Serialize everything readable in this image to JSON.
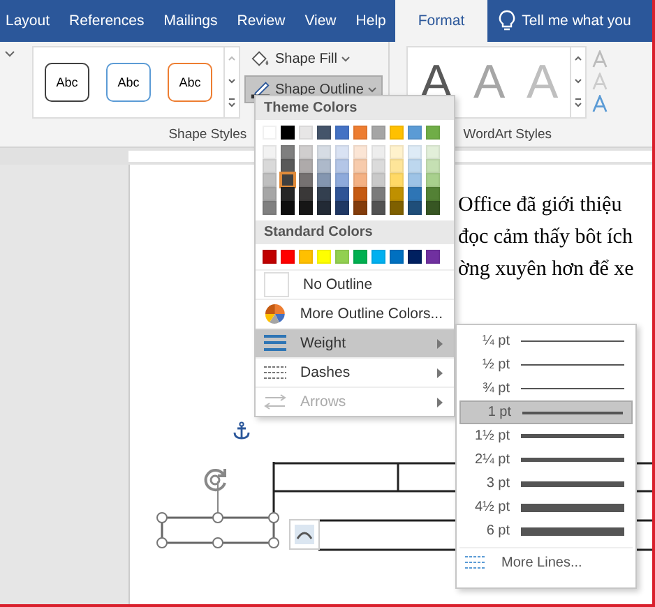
{
  "tabs": [
    {
      "label": "Layout",
      "selected": false
    },
    {
      "label": "References",
      "selected": false
    },
    {
      "label": "Mailings",
      "selected": false
    },
    {
      "label": "Review",
      "selected": false
    },
    {
      "label": "View",
      "selected": false
    },
    {
      "label": "Help",
      "selected": false
    },
    {
      "label": "Format",
      "selected": true
    }
  ],
  "tell_me": "Tell me what you",
  "ribbon": {
    "shape_styles": {
      "group_label": "Shape Styles",
      "samples": [
        {
          "label": "Abc",
          "color": "#404040"
        },
        {
          "label": "Abc",
          "color": "#5b9bd5"
        },
        {
          "label": "Abc",
          "color": "#ed7d31"
        }
      ]
    },
    "shape_fill": {
      "label": "Shape Fill",
      "pressed": false
    },
    "shape_outline": {
      "label": "Shape Outline",
      "pressed": true
    },
    "wordart": {
      "group_label": "WordArt Styles",
      "samples": [
        {
          "label": "A",
          "color": "#595959"
        },
        {
          "label": "A",
          "color": "#a6a6a6"
        },
        {
          "label": "A",
          "color": "#bfbfbf"
        }
      ]
    }
  },
  "document": {
    "text_lines": [
      "Office đã giới thiệu",
      "đọc cảm thấy bôt ích",
      "ờng xuyên hơn để xe"
    ]
  },
  "outline_menu": {
    "theme_title": "Theme Colors",
    "theme_colors": [
      [
        {
          "color": "#ffffff",
          "selected": false
        },
        {
          "color": "#000000",
          "selected": false
        },
        {
          "color": "#e7e6e6",
          "selected": false
        },
        {
          "color": "#44546a",
          "selected": false
        },
        {
          "color": "#4472c4",
          "selected": false
        },
        {
          "color": "#ed7d31",
          "selected": false
        },
        {
          "color": "#a5a5a5",
          "selected": false
        },
        {
          "color": "#ffc000",
          "selected": false
        },
        {
          "color": "#5b9bd5",
          "selected": false
        },
        {
          "color": "#70ad47",
          "selected": false
        }
      ],
      [
        {
          "color": "#f2f2f2",
          "selected": false
        },
        {
          "color": "#7f7f7f",
          "selected": false
        },
        {
          "color": "#d0cece",
          "selected": false
        },
        {
          "color": "#d6dce4",
          "selected": false
        },
        {
          "color": "#d9e2f3",
          "selected": false
        },
        {
          "color": "#fbe5d5",
          "selected": false
        },
        {
          "color": "#ededed",
          "selected": false
        },
        {
          "color": "#fff2cc",
          "selected": false
        },
        {
          "color": "#deebf6",
          "selected": false
        },
        {
          "color": "#e2efd9",
          "selected": false
        }
      ],
      [
        {
          "color": "#d9d9d9",
          "selected": false
        },
        {
          "color": "#595959",
          "selected": false
        },
        {
          "color": "#aeaaaa",
          "selected": false
        },
        {
          "color": "#adb9ca",
          "selected": false
        },
        {
          "color": "#b4c6e7",
          "selected": false
        },
        {
          "color": "#f7cbac",
          "selected": false
        },
        {
          "color": "#dbdbdb",
          "selected": false
        },
        {
          "color": "#fee599",
          "selected": false
        },
        {
          "color": "#bdd7ee",
          "selected": false
        },
        {
          "color": "#c5e0b3",
          "selected": false
        }
      ],
      [
        {
          "color": "#bfbfbf",
          "selected": false
        },
        {
          "color": "#404040",
          "selected": true
        },
        {
          "color": "#757171",
          "selected": false
        },
        {
          "color": "#8496b0",
          "selected": false
        },
        {
          "color": "#8eaadb",
          "selected": false
        },
        {
          "color": "#f4b183",
          "selected": false
        },
        {
          "color": "#c9c9c9",
          "selected": false
        },
        {
          "color": "#ffd965",
          "selected": false
        },
        {
          "color": "#9dc3e6",
          "selected": false
        },
        {
          "color": "#a8d08d",
          "selected": false
        }
      ],
      [
        {
          "color": "#a6a6a6",
          "selected": false
        },
        {
          "color": "#262626",
          "selected": false
        },
        {
          "color": "#3a3838",
          "selected": false
        },
        {
          "color": "#333f4f",
          "selected": false
        },
        {
          "color": "#2f5496",
          "selected": false
        },
        {
          "color": "#c55a11",
          "selected": false
        },
        {
          "color": "#7b7b7b",
          "selected": false
        },
        {
          "color": "#bf9000",
          "selected": false
        },
        {
          "color": "#2e75b5",
          "selected": false
        },
        {
          "color": "#538135",
          "selected": false
        }
      ],
      [
        {
          "color": "#808080",
          "selected": false
        },
        {
          "color": "#0d0d0d",
          "selected": false
        },
        {
          "color": "#161616",
          "selected": false
        },
        {
          "color": "#222a35",
          "selected": false
        },
        {
          "color": "#1f3864",
          "selected": false
        },
        {
          "color": "#833c0b",
          "selected": false
        },
        {
          "color": "#525252",
          "selected": false
        },
        {
          "color": "#7f6000",
          "selected": false
        },
        {
          "color": "#1f4e79",
          "selected": false
        },
        {
          "color": "#375623",
          "selected": false
        }
      ]
    ],
    "standard_title": "Standard Colors",
    "standard_colors": [
      {
        "color": "#c00000",
        "selected": false
      },
      {
        "color": "#ff0000",
        "selected": false
      },
      {
        "color": "#ffc000",
        "selected": false
      },
      {
        "color": "#ffff00",
        "selected": false
      },
      {
        "color": "#92d050",
        "selected": false
      },
      {
        "color": "#00b050",
        "selected": false
      },
      {
        "color": "#00b0f0",
        "selected": false
      },
      {
        "color": "#0070c0",
        "selected": false
      },
      {
        "color": "#002060",
        "selected": false
      },
      {
        "color": "#7030a0",
        "selected": false
      }
    ],
    "items": [
      {
        "kind": "no-outline",
        "label": "No Outline",
        "selected": false,
        "disabled": false,
        "submenu": false
      },
      {
        "kind": "more-colors",
        "label": "More Outline Colors...",
        "selected": false,
        "disabled": false,
        "submenu": false
      },
      {
        "kind": "weight",
        "label": "Weight",
        "selected": true,
        "disabled": false,
        "submenu": true
      },
      {
        "kind": "dashes",
        "label": "Dashes",
        "selected": false,
        "disabled": false,
        "submenu": true
      },
      {
        "kind": "arrows",
        "label": "Arrows",
        "selected": false,
        "disabled": true,
        "submenu": true
      }
    ]
  },
  "weight_menu": {
    "items": [
      {
        "label": "¼ pt",
        "kind": "hairline",
        "selected": false
      },
      {
        "label": "½ pt",
        "kind": "hairline",
        "selected": false
      },
      {
        "label": "¾ pt",
        "kind": "hairline",
        "selected": false
      },
      {
        "label": "1 pt",
        "kind": "thin",
        "selected": true
      },
      {
        "label": "1½ pt",
        "kind": "medium",
        "selected": false
      },
      {
        "label": "2¼ pt",
        "kind": "medium",
        "selected": false
      },
      {
        "label": "3 pt",
        "kind": "thick",
        "selected": false
      },
      {
        "label": "4½ pt",
        "kind": "heavy",
        "selected": false
      },
      {
        "label": "6 pt",
        "kind": "heavy",
        "selected": false
      }
    ],
    "more": "More Lines..."
  }
}
